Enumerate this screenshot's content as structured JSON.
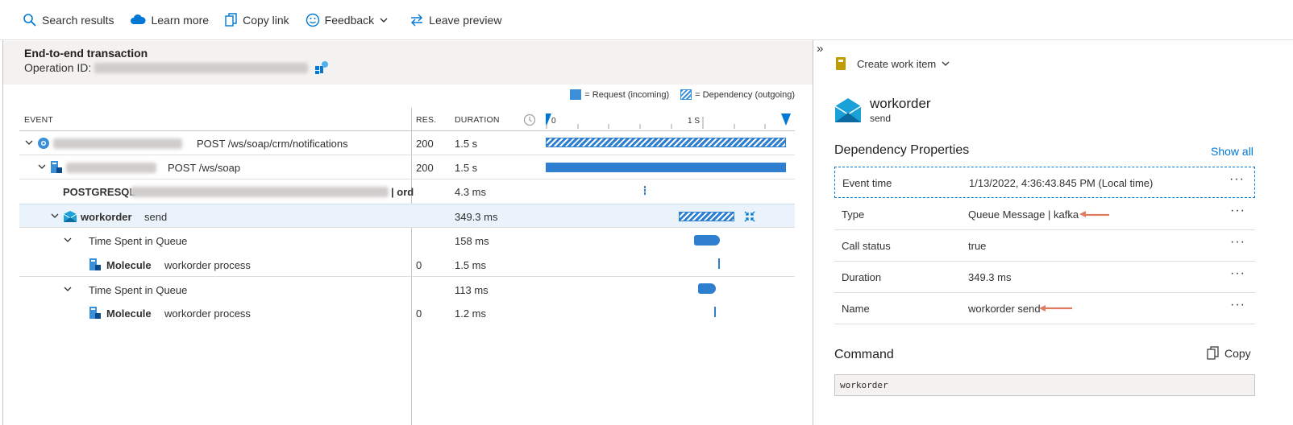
{
  "toolbar": {
    "search": "Search results",
    "learn": "Learn more",
    "copy_link": "Copy link",
    "feedback": "Feedback",
    "leave": "Leave preview"
  },
  "header": {
    "title": "End-to-end transaction",
    "op_label": "Operation ID:"
  },
  "legend": {
    "request": "= Request (incoming)",
    "dependency": "= Dependency (outgoing)"
  },
  "columns": {
    "event": "EVENT",
    "res": "RES.",
    "duration": "DURATION",
    "tick0": "0",
    "tick1": "1 S"
  },
  "rows": [
    {
      "name": "",
      "detail": "POST /ws/soap/crm/notifications",
      "res": "200",
      "duration": "1.5 s"
    },
    {
      "name": "",
      "detail": "POST /ws/soap",
      "res": "200",
      "duration": "1.5 s"
    },
    {
      "name": "POSTGRESQL",
      "detail": "| ord",
      "res": "",
      "duration": "4.3 ms"
    },
    {
      "name": "workorder",
      "detail": "send",
      "res": "",
      "duration": "349.3 ms"
    },
    {
      "name": "Time Spent in Queue",
      "detail": "",
      "res": "",
      "duration": "158 ms"
    },
    {
      "name": "Molecule",
      "detail": "workorder process",
      "res": "0",
      "duration": "1.5 ms"
    },
    {
      "name": "Time Spent in Queue",
      "detail": "",
      "res": "",
      "duration": "113 ms"
    },
    {
      "name": "Molecule",
      "detail": "workorder process",
      "res": "0",
      "duration": "1.2 ms"
    }
  ],
  "panel": {
    "create_work_item": "Create work item",
    "title": "workorder",
    "subtitle": "send",
    "section": "Dependency Properties",
    "show_all": "Show all",
    "props": [
      {
        "key": "Event time",
        "value": "1/13/2022, 4:36:43.845 PM (Local time)"
      },
      {
        "key": "Type",
        "value": "Queue Message | kafka"
      },
      {
        "key": "Call status",
        "value": "true"
      },
      {
        "key": "Duration",
        "value": "349.3 ms"
      },
      {
        "key": "Name",
        "value": "workorder send"
      }
    ],
    "more": "···",
    "command_title": "Command",
    "copy": "Copy",
    "command": "workorder"
  },
  "colors": {
    "accent": "#0078d4",
    "bar": "#2f7fd0",
    "arrow": "#e07a5f"
  }
}
